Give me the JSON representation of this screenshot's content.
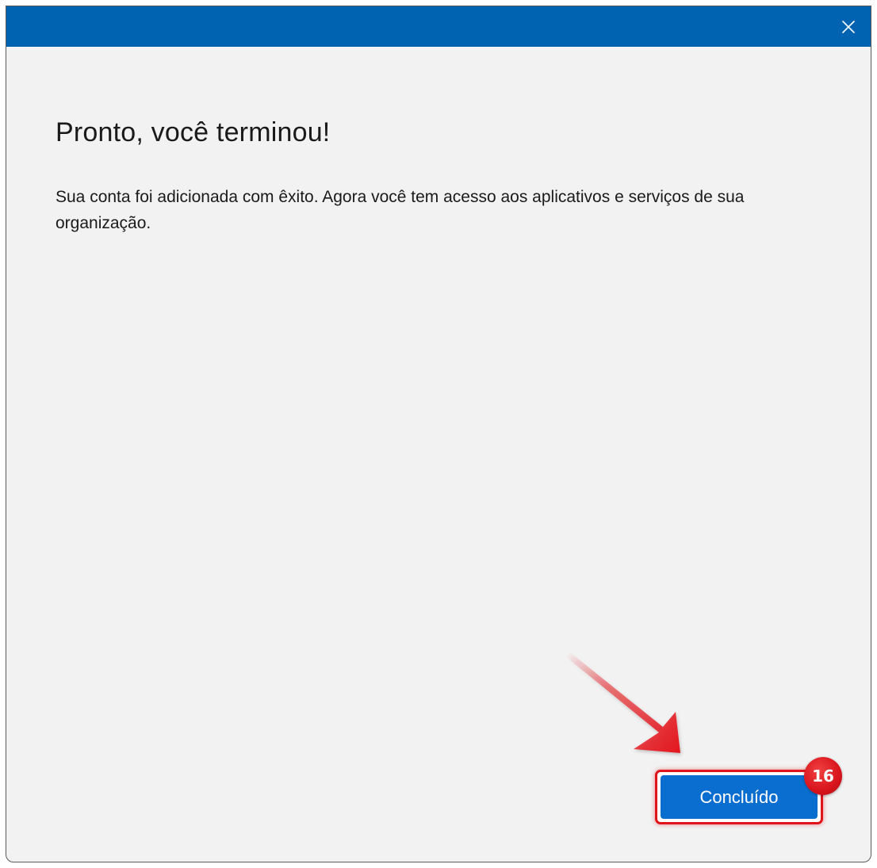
{
  "dialog": {
    "close_icon": "close-icon",
    "title": "Pronto, você terminou!",
    "message": "Sua conta foi adicionada com êxito. Agora você tem acesso aos aplicativos e serviços de sua organização.",
    "done_label": "Concluído"
  },
  "annotation": {
    "step_number": "16",
    "arrow_icon": "arrow-pointer-icon",
    "highlight_color": "#e0141c"
  },
  "colors": {
    "titlebar": "#0063b1",
    "button": "#0a6ed1",
    "background": "#f2f2f2"
  }
}
